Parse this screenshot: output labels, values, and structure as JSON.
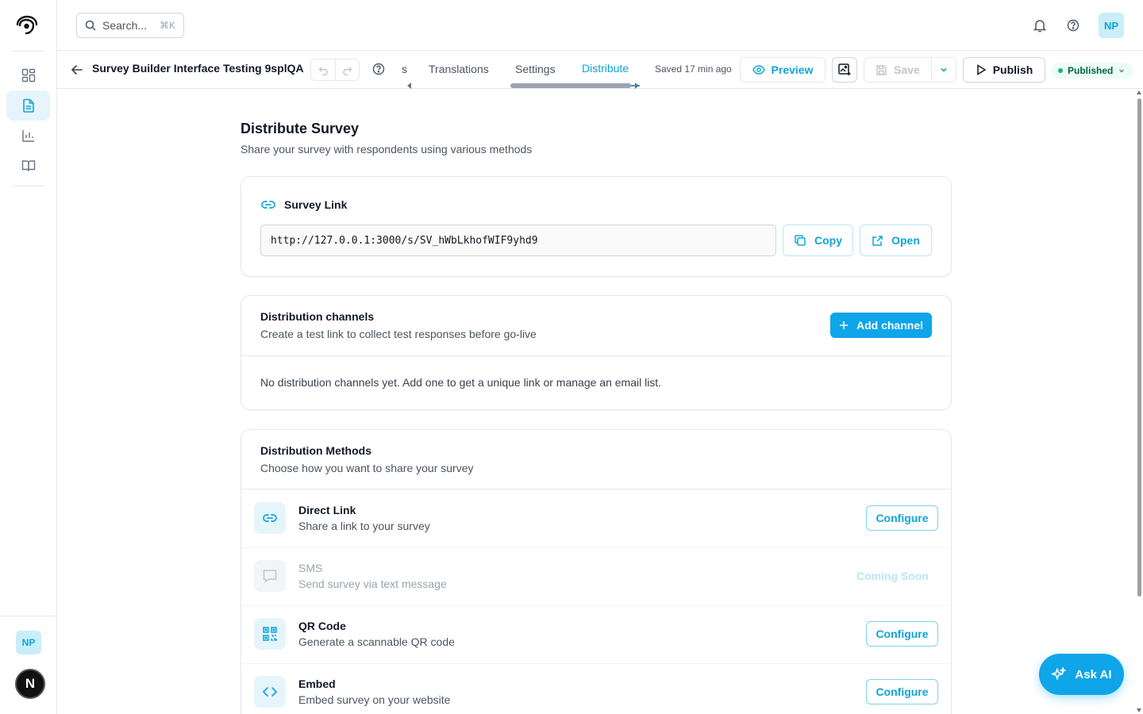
{
  "topbar": {
    "search_placeholder": "Search...",
    "search_shortcut": "⌘K",
    "user_initials": "NP"
  },
  "rail": {
    "items": [
      {
        "icon": "dashboard-icon",
        "active": false
      },
      {
        "icon": "document-icon",
        "active": true
      },
      {
        "icon": "chart-icon",
        "active": false
      },
      {
        "icon": "book-icon",
        "active": false
      }
    ],
    "user_initials": "NP",
    "badge_letter": "N"
  },
  "toolbar": {
    "survey_title": "Survey Builder Interface Testing 9splQA",
    "tab_fragment": "s",
    "tabs": [
      {
        "label": "Translations",
        "active": false
      },
      {
        "label": "Settings",
        "active": false
      },
      {
        "label": "Distribute",
        "active": true
      }
    ],
    "saved_text": "Saved 17 min ago",
    "preview_label": "Preview",
    "save_label": "Save",
    "publish_label": "Publish",
    "status_label": "Published"
  },
  "page": {
    "title": "Distribute Survey",
    "subtitle": "Share your survey with respondents using various methods"
  },
  "survey_link": {
    "heading": "Survey Link",
    "url": "http://127.0.0.1:3000/s/SV_hWbLkhofWIF9yhd9",
    "copy_label": "Copy",
    "open_label": "Open"
  },
  "channels": {
    "title": "Distribution channels",
    "subtitle": "Create a test link to collect test responses before go-live",
    "add_label": "Add channel",
    "empty_text": "No distribution channels yet. Add one to get a unique link or manage an email list."
  },
  "methods": {
    "title": "Distribution Methods",
    "subtitle": "Choose how you want to share your survey",
    "items": [
      {
        "name": "Direct Link",
        "description": "Share a link to your survey",
        "action": "Configure",
        "icon": "link-icon",
        "enabled": true
      },
      {
        "name": "SMS",
        "description": "Send survey via text message",
        "action": "Coming Soon",
        "icon": "message-icon",
        "enabled": false
      },
      {
        "name": "QR Code",
        "description": "Generate a scannable QR code",
        "action": "Configure",
        "icon": "qr-code-icon",
        "enabled": true
      },
      {
        "name": "Embed",
        "description": "Embed survey on your website",
        "action": "Configure",
        "icon": "code-icon",
        "enabled": true
      }
    ]
  },
  "ask_ai_label": "Ask AI",
  "colors": {
    "accent": "#0ea5e9",
    "accent_text": "#0ea5d8",
    "status_green": "#10b981"
  }
}
